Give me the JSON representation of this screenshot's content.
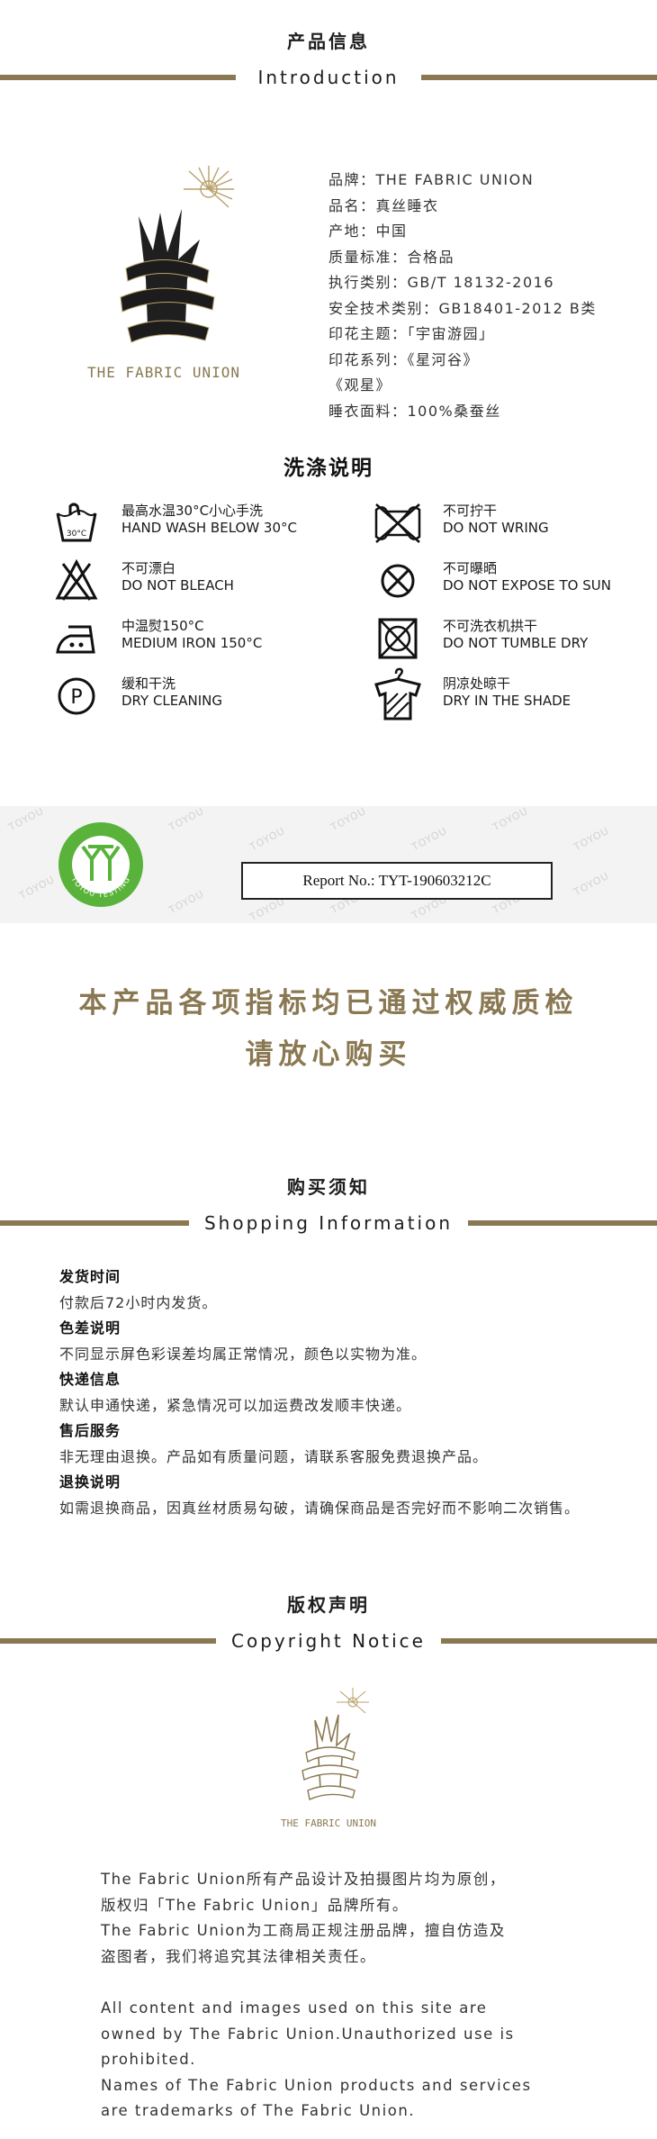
{
  "intro": {
    "title_cn": "产品信息",
    "title_en": "Introduction",
    "brand_logo_text": "THE FABRIC UNION",
    "lines": [
      "品牌：THE FABRIC UNION",
      "品名：真丝睡衣",
      "产地：中国",
      "质量标准：合格品",
      "执行类别：GB/T 18132-2016",
      "安全技术类别：GB18401-2012 B类",
      "印花主题：「宇宙游园」",
      "印花系列：《星河谷》",
      "《观星》",
      "睡衣面料：100%桑蚕丝"
    ]
  },
  "washing": {
    "title": "洗涤说明",
    "tub_temp": "30°C",
    "items": [
      {
        "icon": "hand-wash-icon",
        "cn": "最高水温30°C小心手洗",
        "en": "HAND WASH BELOW 30°C"
      },
      {
        "icon": "do-not-wring-icon",
        "cn": "不可拧干",
        "en": "DO NOT WRING"
      },
      {
        "icon": "do-not-bleach-icon",
        "cn": "不可漂白",
        "en": "DO NOT BLEACH"
      },
      {
        "icon": "do-not-sun-icon",
        "cn": "不可曝晒",
        "en": "DO NOT EXPOSE TO SUN"
      },
      {
        "icon": "medium-iron-icon",
        "cn": "中温熨150°C",
        "en": "MEDIUM IRON 150°C"
      },
      {
        "icon": "no-tumble-dry-icon",
        "cn": "不可洗衣机拱干",
        "en": "DO NOT TUMBLE DRY"
      },
      {
        "icon": "dry-cleaning-icon",
        "cn": "缓和干洗",
        "en": "DRY CLEANING"
      },
      {
        "icon": "dry-in-shade-icon",
        "cn": "阴凉处晾干",
        "en": "DRY IN THE SHADE"
      }
    ]
  },
  "report": {
    "watermark": "TOYOU",
    "badge_text": "TOYOU TESTING",
    "report_no": "Report No.: TYT-190603212C"
  },
  "slogan": {
    "line1": "本产品各项指标均已通过权威质检",
    "line2": "请放心购买"
  },
  "shopping": {
    "title_cn": "购买须知",
    "title_en": "Shopping Information",
    "items": [
      {
        "heading": "发货时间",
        "text": "付款后72小时内发货。"
      },
      {
        "heading": "色差说明",
        "text": "不同显示屏色彩误差均属正常情况，颜色以实物为准。"
      },
      {
        "heading": "快递信息",
        "text": "默认申通快递，紧急情况可以加运费改发顺丰快递。"
      },
      {
        "heading": "售后服务",
        "text": "非无理由退换。产品如有质量问题，请联系客服免费退换产品。"
      },
      {
        "heading": "退换说明",
        "text": "如需退换商品，因真丝材质易勾破，请确保商品是否完好而不影响二次销售。"
      }
    ]
  },
  "copyright": {
    "title_cn": "版权声明",
    "title_en": "Copyright Notice",
    "brand_logo_text": "THE FABRIC UNION",
    "cn_lines": [
      "The Fabric Union所有产品设计及拍摄图片均为原创，",
      "版权归「The Fabric Union」品牌所有。",
      "The Fabric Union为工商局正规注册品牌，擅自仿造及",
      "盗图者，我们将追究其法律相关责任。"
    ],
    "en_lines": [
      "All content and images used on this site are",
      "owned by The Fabric Union.Unauthorized use is",
      "prohibited.",
      "Names of The Fabric Union products and services",
      "are trademarks of The Fabric Union."
    ]
  },
  "colors": {
    "gold": "#8a7852",
    "badge_green": "#59b33a",
    "text": "#333333"
  }
}
